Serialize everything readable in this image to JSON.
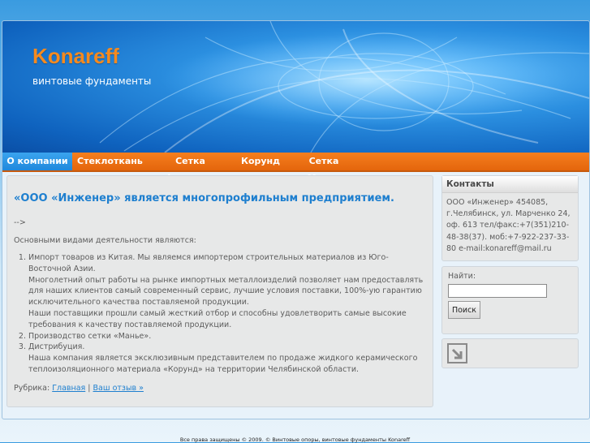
{
  "site": {
    "title": "Konareff",
    "description": "винтовые фундаменты"
  },
  "nav": {
    "items": [
      {
        "label": "О компании",
        "active": true
      },
      {
        "label": "Стеклоткань",
        "active": false
      },
      {
        "label": "Сетка фасадная",
        "active": false
      },
      {
        "label": "Корунд",
        "active": false
      },
      {
        "label": "Сетка Манье",
        "active": false
      }
    ]
  },
  "post": {
    "title": "«ООО «Инженер» является многопрофильным предприятием.",
    "stray": "-->",
    "intro": "Основными видами деятельности являются:",
    "items": [
      {
        "lines": [
          "Импорт товаров из Китая. Мы являемся импортером строительных материалов из Юго-Восточной Азии.",
          "Многолетний опыт работы на рынке импортных металлоизделий позволяет нам предоставлять для наших клиентов самый современный сервис, лучшие условия поставки, 100%-ую гарантию исключительного качества поставляемой продукции.",
          "Наши поставщики прошли самый жесткий отбор и способны удовлетворить самые высокие требования к качеству поставляемой продукции."
        ]
      },
      {
        "lines": [
          "Производство сетки «Манье»."
        ]
      },
      {
        "lines": [
          "Дистрибуция.",
          "Наша компания является эксклюзивным представителем по продаже жидкого керамического теплоизоляционного материала «Корунд» на территории Челябинской области."
        ]
      }
    ],
    "rubric_label": "Рубрика:",
    "rubric_link": "Главная",
    "separator": "|",
    "review_link": "Ваш отзыв »"
  },
  "sidebar": {
    "contacts": {
      "heading": "Контакты",
      "text": "ООО «Инженер» 454085, г.Челябинск, ул. Марченко 24, оф. 613 тел/факс:+7(351)210-48-38(37). моб:+7-922-237-33-80 e-mail:konareff@mail.ru"
    },
    "search": {
      "label": "Найти:",
      "value": "",
      "button": "Поиск"
    }
  },
  "footer": {
    "text": "Все права защищены © 2009. © Винтовые опоры, винтовые фундаменты Konareff"
  },
  "colors": {
    "accent_orange": "#f58a1f",
    "nav_orange": "#e4650c",
    "link_blue": "#1e7fcf"
  },
  "icons": {
    "rss": "arrow-out-icon"
  }
}
